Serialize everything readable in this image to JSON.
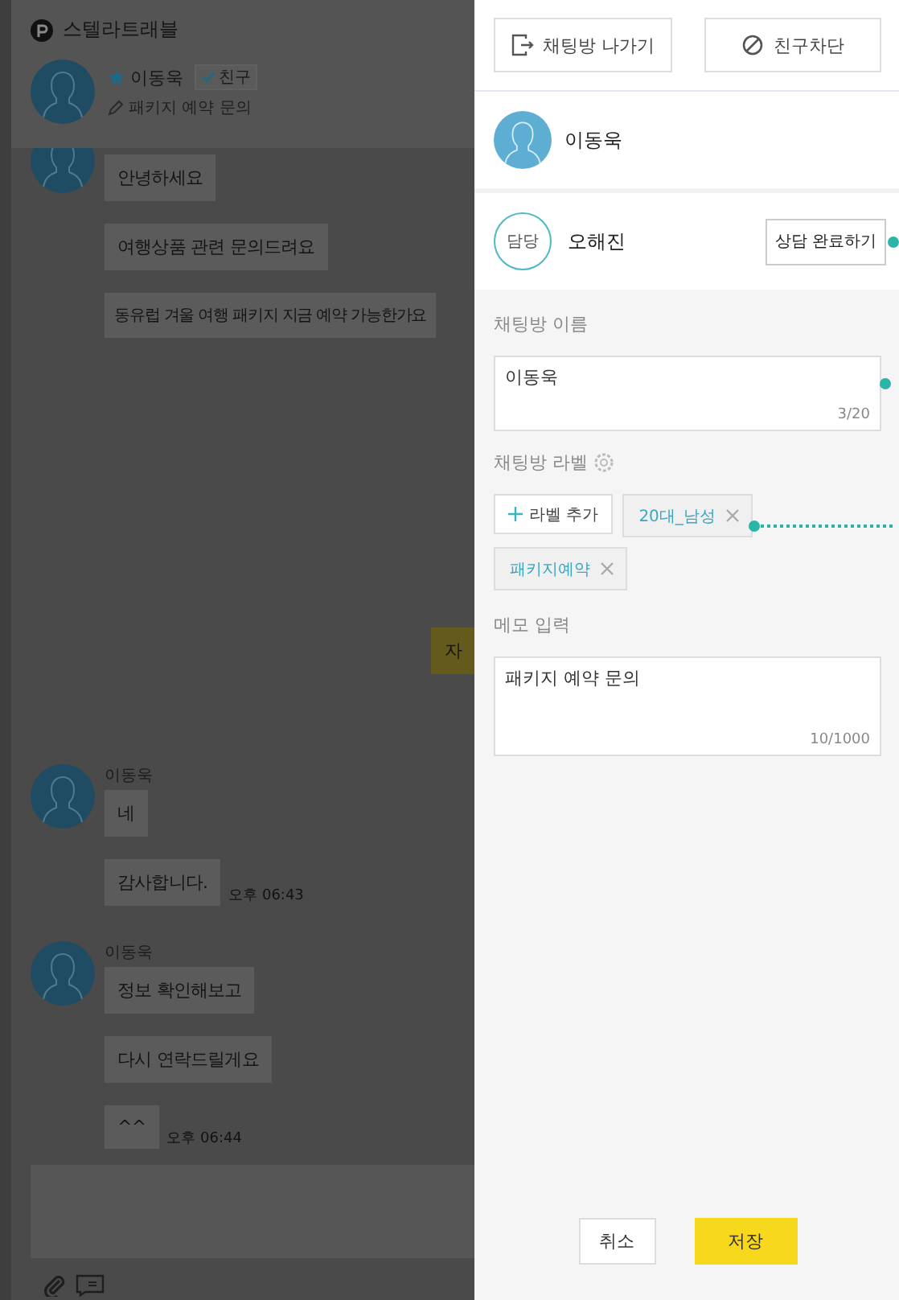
{
  "app": {
    "title": "스텔라트래블"
  },
  "chat_header": {
    "name": "이동욱",
    "starred": true,
    "friend_badge": "친구",
    "memo": "패키지 예약 문의"
  },
  "message_groups": [
    {
      "kind": "incoming",
      "messages": [
        {
          "text": "안녕하세요"
        },
        {
          "text": "여행상품 관련 문의드려요"
        },
        {
          "text": "동유럽 겨울 여행 패키지 지금 예약 가능한가요"
        }
      ]
    },
    {
      "kind": "outgoing",
      "messages": [
        {
          "text": "자"
        }
      ]
    },
    {
      "kind": "incoming",
      "sender": "이동욱",
      "messages": [
        {
          "text": "네"
        },
        {
          "text": "감사합니다.",
          "time": "오후 06:43"
        }
      ]
    },
    {
      "kind": "incoming",
      "sender": "이동욱",
      "messages": [
        {
          "text": "정보 확인해보고"
        },
        {
          "text": "다시 연락드릴게요"
        },
        {
          "text": "^^",
          "time": "오후 06:44"
        }
      ]
    }
  ],
  "actions": [
    {
      "kind": "leave",
      "label": "채팅방 나가기"
    },
    {
      "kind": "block",
      "label": "친구차단"
    }
  ],
  "profile": {
    "name": "이동욱"
  },
  "agent": {
    "badge": "담당",
    "name": "오해진",
    "button": "상담 완료하기"
  },
  "room_name": {
    "label": "채팅방 이름",
    "value": "이동욱",
    "counter": "3/20"
  },
  "room_labels": {
    "label": "채팅방 라벨",
    "add_button": "라벨 추가",
    "tags": [
      "20대_남성",
      "패키지예약"
    ]
  },
  "memo": {
    "label": "메모 입력",
    "value": "패키지 예약 문의",
    "counter": "10/1000"
  },
  "footer_buttons": [
    {
      "kind": "cancel",
      "label": "취소"
    },
    {
      "kind": "save",
      "label": "저장"
    }
  ]
}
